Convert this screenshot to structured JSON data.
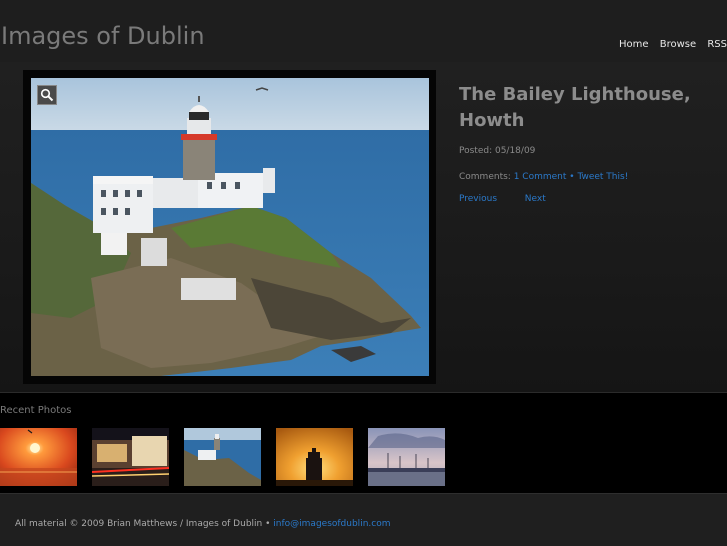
{
  "site": {
    "title": "Images of Dublin"
  },
  "nav": {
    "home": "Home",
    "browse": "Browse",
    "rss": "RSS"
  },
  "post": {
    "title_line1": "The Bailey Lighthouse,",
    "title_line2": "Howth",
    "posted_label": "Posted: 05/18/09",
    "comments_label": "Comments:",
    "comment_link": "1 Comment",
    "separator": "•",
    "tweet_link": "Tweet This!",
    "previous": "Previous",
    "next": "Next"
  },
  "recent": {
    "title": "Recent Photos"
  },
  "footer": {
    "text": "All material © 2009 Brian Matthews / Images of Dublin •",
    "email": "info@imagesofdublin.com"
  },
  "icons": {
    "zoom": "magnifier-icon"
  },
  "colors": {
    "link": "#2b79c9",
    "background": "#1c1c1c"
  }
}
